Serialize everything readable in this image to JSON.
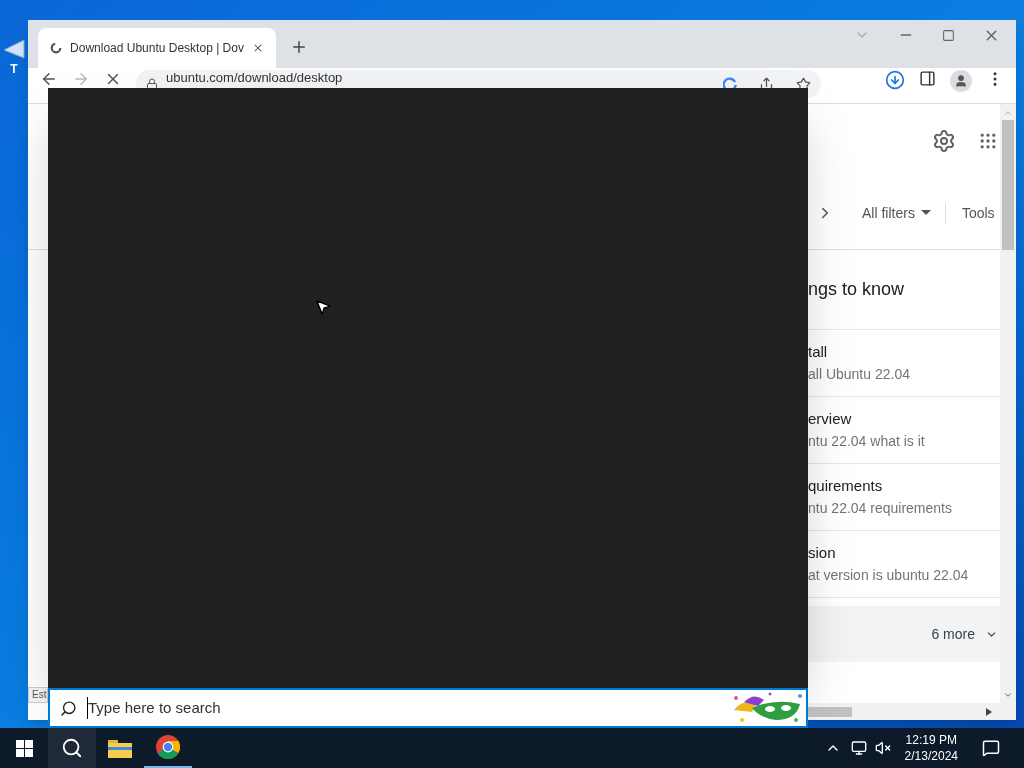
{
  "desktop": {
    "icon_label": "T"
  },
  "browser": {
    "tabs": [
      {
        "title": "Download Ubuntu Desktop | Dov",
        "selected": true
      }
    ],
    "toolbar": {
      "url": "ubuntu.com/download/desktop",
      "forward_disabled": true
    },
    "page": {
      "filters": [
        {
          "label": "All filters",
          "kind": "dropdown"
        },
        {
          "label": "Tools",
          "kind": "plain"
        }
      ],
      "heading": "ngs to know",
      "results": [
        {
          "title": "tall",
          "subtitle": "all Ubuntu 22.04"
        },
        {
          "title": "erview",
          "subtitle": "ntu 22.04 what is it"
        },
        {
          "title": "quirements",
          "subtitle": "ntu 22.04 requirements"
        },
        {
          "title": "sion",
          "subtitle": "at version is ubuntu 22.04"
        }
      ],
      "more": "6 more"
    },
    "status_bubble": "Est"
  },
  "search_flyout": {
    "placeholder": "Type here to search"
  },
  "taskbar": {
    "apps": [
      {
        "kind": "search",
        "active": false
      },
      {
        "kind": "explorer",
        "active": false
      },
      {
        "kind": "chrome",
        "active": true
      }
    ],
    "time": "12:19 PM",
    "date": "2/13/2024"
  }
}
